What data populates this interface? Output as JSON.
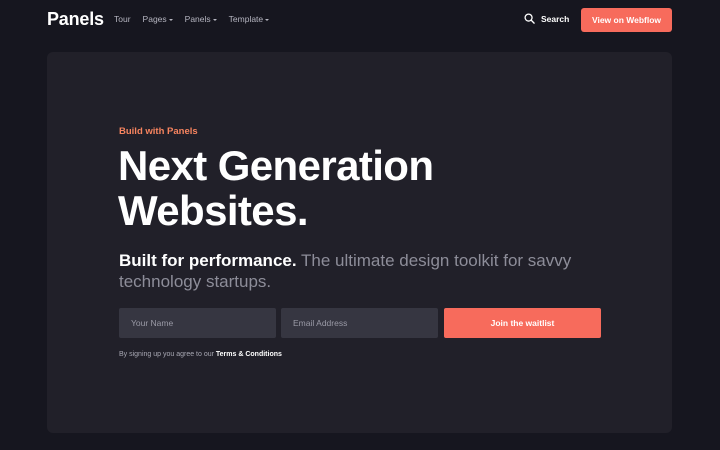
{
  "nav": {
    "logo": "Panels",
    "items": [
      {
        "label": "Tour",
        "dropdown": false
      },
      {
        "label": "Pages",
        "dropdown": true
      },
      {
        "label": "Panels",
        "dropdown": true
      },
      {
        "label": "Template",
        "dropdown": true
      }
    ],
    "search_label": "Search",
    "cta_label": "View on Webflow"
  },
  "hero": {
    "eyebrow": "Build with Panels",
    "headline_line1": "Next Generation",
    "headline_line2": "Websites.",
    "sub_strong": "Built for performance.",
    "sub_rest": " The ultimate design toolkit for savvy technology startups."
  },
  "form": {
    "name_placeholder": "Your Name",
    "email_placeholder": "Email Address",
    "submit_label": "Join the waitlist",
    "terms_prefix": "By signing up you agree to our ",
    "terms_link": "Terms & Conditions"
  },
  "colors": {
    "background": "#16161f",
    "panel": "#212029",
    "accent": "#f76b5c",
    "eyebrow": "#f7845f"
  },
  "icons": {
    "search": "search-icon",
    "caret": "chevron-down-icon"
  }
}
